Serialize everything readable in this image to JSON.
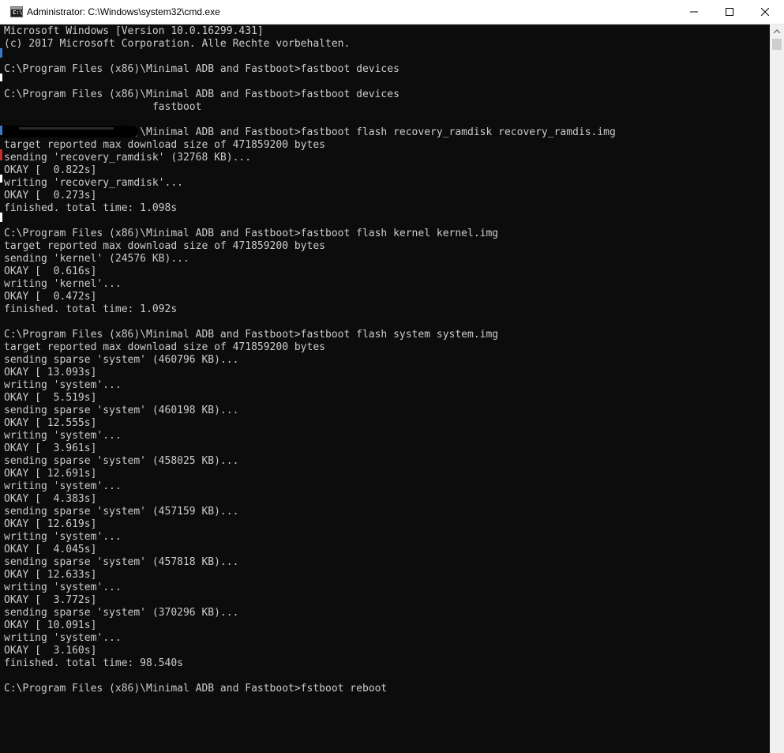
{
  "window": {
    "title": "Administrator: C:\\Windows\\system32\\cmd.exe",
    "icon_glyph": "C:\\",
    "controls": {
      "minimize_icon": "minimize-icon",
      "maximize_icon": "maximize-icon",
      "close_icon": "close-icon"
    }
  },
  "console": {
    "colors": {
      "background": "#0c0c0c",
      "foreground": "#cccccc"
    },
    "lines": [
      "Microsoft Windows [Version 10.0.16299.431]",
      "(c) 2017 Microsoft Corporation. Alle Rechte vorbehalten.",
      "",
      "C:\\Program Files (x86)\\Minimal ADB and Fastboot>fastboot devices",
      "",
      "C:\\Program Files (x86)\\Minimal ADB and Fastboot>fastboot devices",
      "                        fastboot",
      "",
      "C:\\Program Files (x86)\\Minimal ADB and Fastboot>fastboot flash recovery_ramdisk recovery_ramdis.img",
      "target reported max download size of 471859200 bytes",
      "sending 'recovery_ramdisk' (32768 KB)...",
      "OKAY [  0.822s]",
      "writing 'recovery_ramdisk'...",
      "OKAY [  0.273s]",
      "finished. total time: 1.098s",
      "",
      "C:\\Program Files (x86)\\Minimal ADB and Fastboot>fastboot flash kernel kernel.img",
      "target reported max download size of 471859200 bytes",
      "sending 'kernel' (24576 KB)...",
      "OKAY [  0.616s]",
      "writing 'kernel'...",
      "OKAY [  0.472s]",
      "finished. total time: 1.092s",
      "",
      "C:\\Program Files (x86)\\Minimal ADB and Fastboot>fastboot flash system system.img",
      "target reported max download size of 471859200 bytes",
      "sending sparse 'system' (460796 KB)...",
      "OKAY [ 13.093s]",
      "writing 'system'...",
      "OKAY [  5.519s]",
      "sending sparse 'system' (460198 KB)...",
      "OKAY [ 12.555s]",
      "writing 'system'...",
      "OKAY [  3.961s]",
      "sending sparse 'system' (458025 KB)...",
      "OKAY [ 12.691s]",
      "writing 'system'...",
      "OKAY [  4.383s]",
      "sending sparse 'system' (457159 KB)...",
      "OKAY [ 12.619s]",
      "writing 'system'...",
      "OKAY [  4.045s]",
      "sending sparse 'system' (457818 KB)...",
      "OKAY [ 12.633s]",
      "writing 'system'...",
      "OKAY [  3.772s]",
      "sending sparse 'system' (370296 KB)...",
      "OKAY [ 10.091s]",
      "writing 'system'...",
      "OKAY [  3.160s]",
      "finished. total time: 98.540s",
      "",
      "C:\\Program Files (x86)\\Minimal ADB and Fastboot>fstboot reboot"
    ]
  },
  "scrollbar": {
    "up_icon": "chevron-up-icon"
  }
}
